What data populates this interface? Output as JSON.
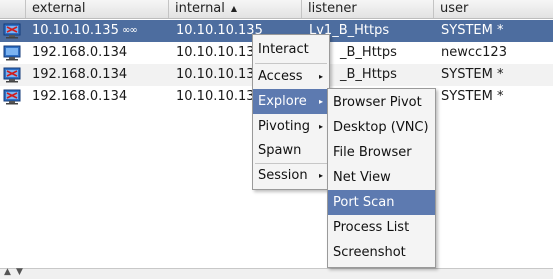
{
  "columns": [
    {
      "label": "external"
    },
    {
      "label": "internal",
      "sort": "▲"
    },
    {
      "label": "listener"
    },
    {
      "label": "user"
    }
  ],
  "rows": [
    {
      "external": "10.10.10.135",
      "link": "∞∞",
      "internal": "10.10.10.135",
      "listener": "Lv1_B_Https",
      "user": "SYSTEM *"
    },
    {
      "external": "192.168.0.134",
      "internal": "10.10.10.13",
      "listener": "_B_Https",
      "user": "newcc123"
    },
    {
      "external": "192.168.0.134",
      "internal": "10.10.10.13",
      "listener": "_B_Https",
      "user": "SYSTEM *"
    },
    {
      "external": "192.168.0.134",
      "internal": "10.10.10.13",
      "listener": "",
      "user": "SYSTEM *"
    }
  ],
  "context_menu": [
    {
      "label": "Interact"
    },
    {
      "label": "Access",
      "arrow": "▸"
    },
    {
      "label": "Explore",
      "arrow": "▸"
    },
    {
      "label": "Pivoting",
      "arrow": "▸"
    },
    {
      "label": "Spawn"
    },
    {
      "label": "Session",
      "arrow": "▸"
    }
  ],
  "explore_submenu": [
    {
      "label": "Browser Pivot"
    },
    {
      "label": "Desktop (VNC)"
    },
    {
      "label": "File Browser"
    },
    {
      "label": "Net View"
    },
    {
      "label": "Port Scan"
    },
    {
      "label": "Process List"
    },
    {
      "label": "Screenshot"
    }
  ],
  "bottom_handles": [
    "▲",
    "▼"
  ],
  "colors": {
    "selected_row": "#4d6d9f",
    "menu_highlight": "#5d7ab0",
    "menu_bg": "#f4f4f4"
  }
}
